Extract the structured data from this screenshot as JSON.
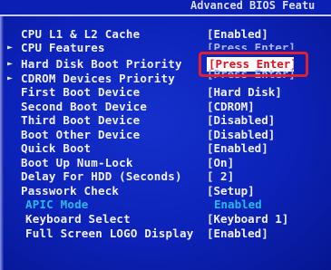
{
  "header": {
    "title": "Advanced BIOS Featu"
  },
  "items": [
    {
      "label": "CPU L1 & L2 Cache",
      "value": "[Enabled]",
      "submenu": false
    },
    {
      "label": "CPU Features",
      "value": "[Press Enter]",
      "submenu": true
    },
    {
      "label": "Hard Disk Boot Priority",
      "value": "[Press Enter]",
      "submenu": true,
      "selected": true
    },
    {
      "label": "CDROM Devices Priority",
      "value": "[Press Enter]",
      "submenu": true
    },
    {
      "label": "First Boot Device",
      "value": "[Hard Disk]",
      "submenu": false
    },
    {
      "label": "Second Boot Device",
      "value": "[CDROM]",
      "submenu": false
    },
    {
      "label": "Third Boot Device",
      "value": "[Disabled]",
      "submenu": false
    },
    {
      "label": "Boot Other Device",
      "value": "[Disabled]",
      "submenu": false
    },
    {
      "label": "Quick Boot",
      "value": "[Enabled]",
      "submenu": false
    },
    {
      "label": "Boot Up Num-Lock",
      "value": "[On]",
      "submenu": false
    },
    {
      "label": "Delay For HDD (Seconds)",
      "value": "[ 2]",
      "submenu": false
    },
    {
      "label": "Passwork Check",
      "value": "[Setup]",
      "submenu": false
    },
    {
      "label": "APIC Mode",
      "value": "Enabled",
      "submenu": false,
      "disabled": true
    },
    {
      "label": "Keyboard Select",
      "value": "[Keyboard 1]",
      "submenu": false
    },
    {
      "label": "Full Screen LOGO Display",
      "value": "[Enabled]",
      "submenu": false
    }
  ],
  "submenu_arrow": "►",
  "colors": {
    "background": "#0c22b8",
    "text": "#eef0ff",
    "disabled": "#29b9e8",
    "selected_bg": "#ffffff",
    "selected_text": "#e01020",
    "highlight_box": "#e02030"
  }
}
